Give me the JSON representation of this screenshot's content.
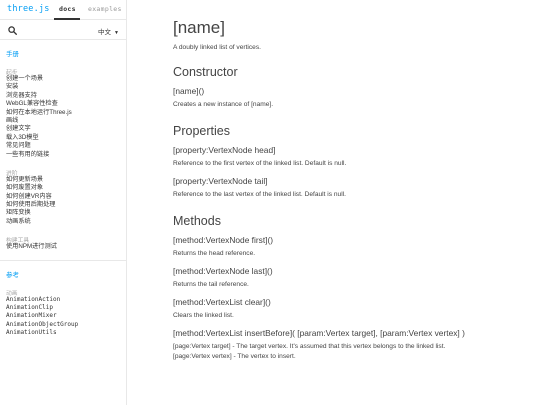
{
  "sidebar": {
    "logo": "three.js",
    "tabs": {
      "docs": "docs",
      "examples": "examples"
    },
    "language": "中文",
    "manual": {
      "title": "手册",
      "groups": [
        {
          "title": "起步",
          "items": [
            "创建一个场景",
            "安装",
            "浏览器支持",
            "WebGL兼容性检查",
            "如何在本地运行Three.js",
            "画线",
            "创建文字",
            "载入3D模型",
            "常见问题",
            "一些有用的链接"
          ]
        },
        {
          "title": "进阶",
          "items": [
            "如何更新场景",
            "如何废置对象",
            "如何创建VR内容",
            "如何使用后期处理",
            "矩阵变换",
            "动画系统"
          ]
        },
        {
          "title": "构建工具",
          "items": [
            "使用NPM进行测试"
          ]
        }
      ]
    },
    "reference": {
      "title": "参考",
      "groups": [
        {
          "title": "动画",
          "items": [
            "AnimationAction",
            "AnimationClip",
            "AnimationMixer",
            "AnimationObjectGroup",
            "AnimationUtils"
          ]
        }
      ]
    }
  },
  "main": {
    "title": "[name]",
    "description": "A doubly linked list of vertices.",
    "constructor": {
      "heading": "Constructor",
      "signature": "[name]()",
      "description": "Creates a new instance of [name]."
    },
    "properties": {
      "heading": "Properties",
      "items": [
        {
          "signature": "[property:VertexNode head]",
          "description": "Reference to the first vertex of the linked list. Default is null."
        },
        {
          "signature": "[property:VertexNode tail]",
          "description": "Reference to the last vertex of the linked list. Default is null."
        }
      ]
    },
    "methods": {
      "heading": "Methods",
      "items": [
        {
          "signature": "[method:VertexNode first]()",
          "description": "Returns the head reference."
        },
        {
          "signature": "[method:VertexNode last]()",
          "description": "Returns the tail reference."
        },
        {
          "signature": "[method:VertexList clear]()",
          "description": "Clears the linked list."
        },
        {
          "signature": "[method:VertexList insertBefore]( [param:Vertex target], [param:Vertex vertex] )",
          "description": "[page:Vertex target] - The target vertex. It's assumed that this vertex belongs to the linked list.",
          "description2": "[page:Vertex vertex] - The vertex to insert."
        }
      ]
    }
  }
}
